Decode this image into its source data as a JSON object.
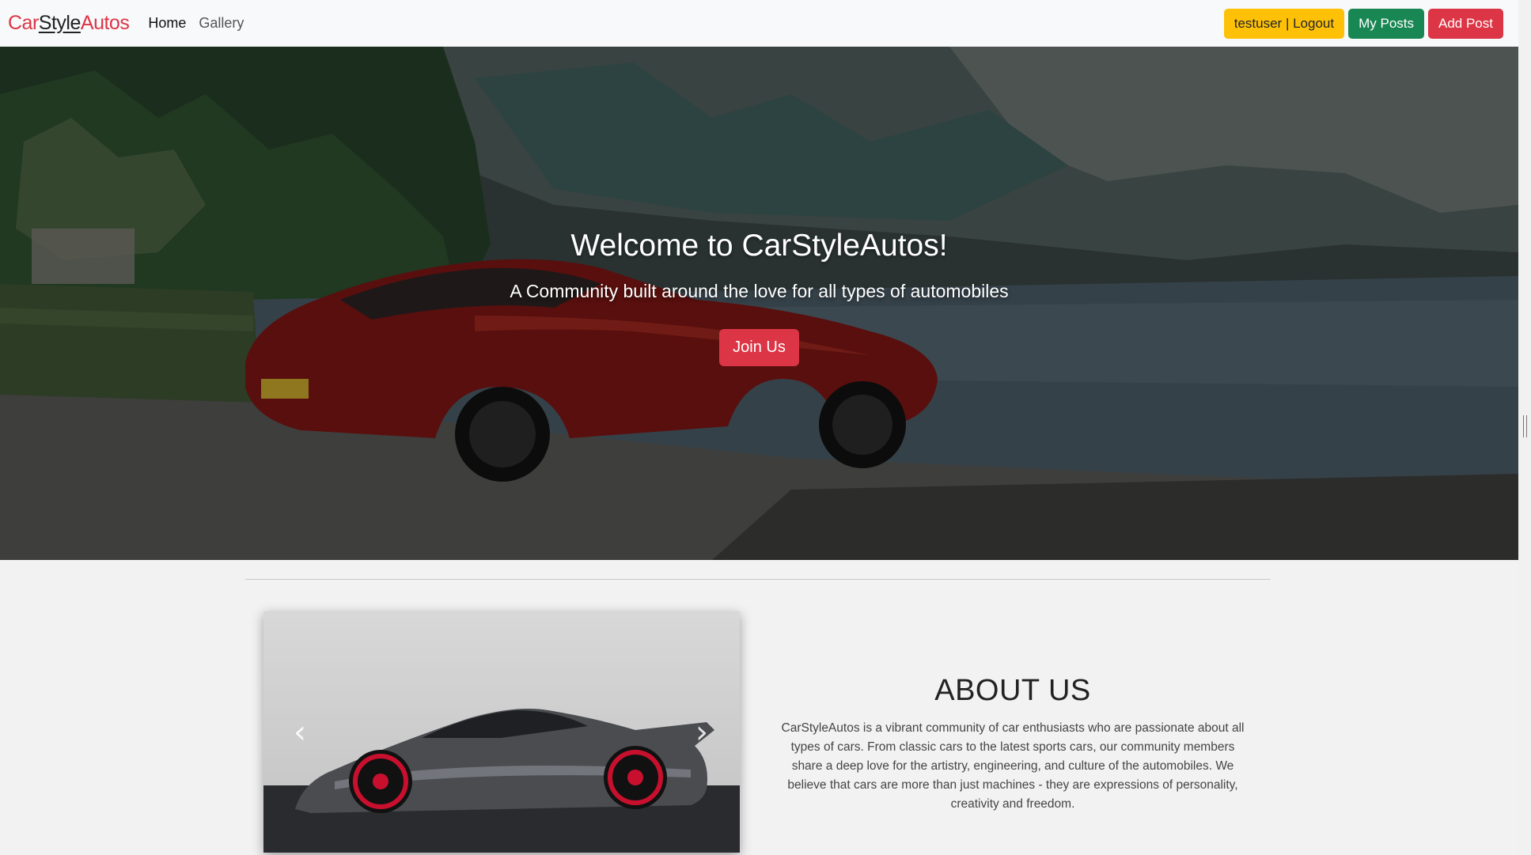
{
  "navbar": {
    "brand": {
      "part1": "Car",
      "part2": "Style",
      "part3": "Autos"
    },
    "links": [
      {
        "label": "Home",
        "active": true
      },
      {
        "label": "Gallery",
        "active": false
      }
    ],
    "buttons": {
      "logout": "testuser | Logout",
      "my_posts": "My Posts",
      "add_post": "Add Post"
    }
  },
  "hero": {
    "title": "Welcome to CarStyleAutos!",
    "subtitle": "A Community built around the love for all types of automobiles",
    "cta": "Join Us"
  },
  "carousel": {
    "prev_icon": "chevron-left-icon",
    "next_icon": "chevron-right-icon"
  },
  "about": {
    "title": "ABOUT US",
    "text": "CarStyleAutos is a vibrant community of car enthusiasts who are passionate about all types of cars. From classic cars to the latest sports cars, our community members share a deep love for the artistry, engineering, and culture of the automobiles. We believe that cars are more than just machines - they are expressions of personality, creativity and freedom."
  },
  "colors": {
    "brand_red": "#dc3545",
    "warning": "#ffc107",
    "success": "#198754",
    "navbar_bg": "#f8f9fa",
    "page_bg": "#f2f2f2"
  }
}
